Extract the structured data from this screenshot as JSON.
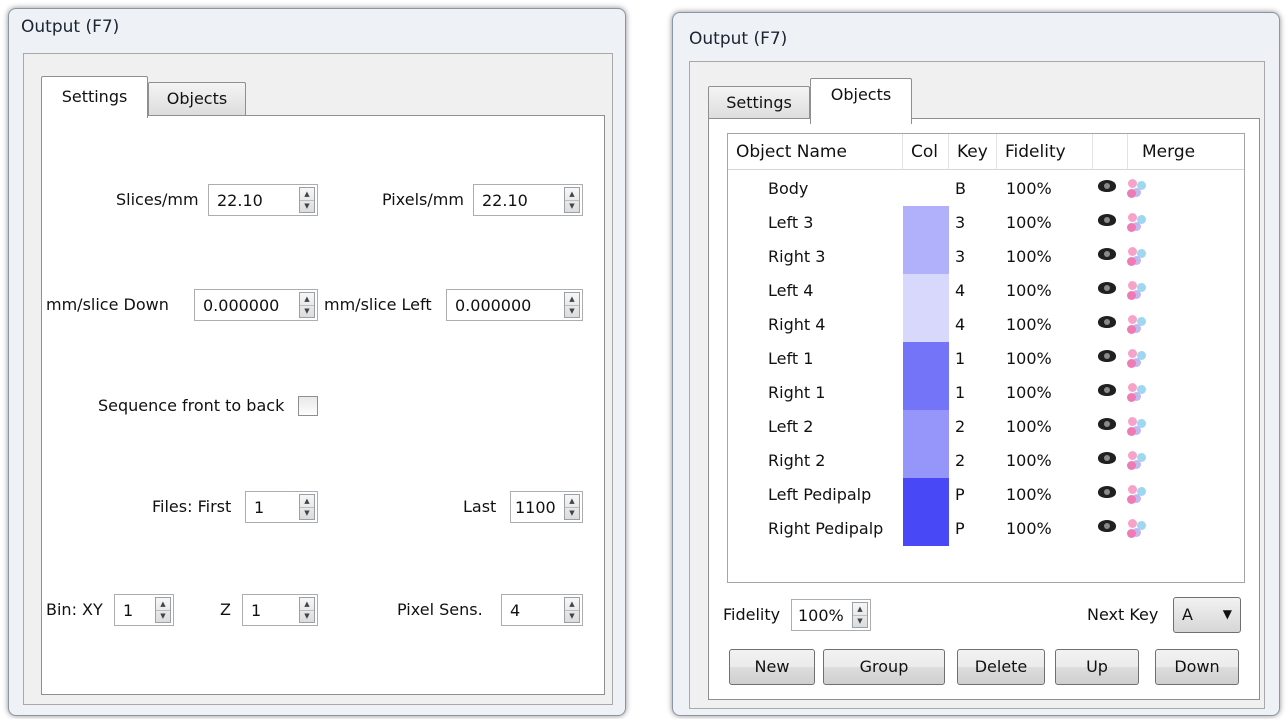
{
  "left_window": {
    "title": "Output (F7)",
    "tabs": [
      {
        "label": "Settings"
      },
      {
        "label": "Objects"
      }
    ],
    "settings": {
      "slices_per_mm": {
        "label": "Slices/mm",
        "value": "22.10"
      },
      "pixels_per_mm": {
        "label": "Pixels/mm",
        "value": "22.10"
      },
      "mm_slice_down": {
        "label": "mm/slice Down",
        "value": "0.000000"
      },
      "mm_slice_left": {
        "label": "mm/slice Left",
        "value": "0.000000"
      },
      "sequence_front_to_back": {
        "label": "Sequence front to back",
        "checked": false
      },
      "files_first": {
        "label": "Files: First",
        "value": "1"
      },
      "files_last": {
        "label": "Last",
        "value": "1100"
      },
      "bin_xy": {
        "label": "Bin: XY",
        "value": "1"
      },
      "bin_z": {
        "label": "Z",
        "value": "1"
      },
      "pixel_sens": {
        "label": "Pixel Sens.",
        "value": "4"
      }
    }
  },
  "right_window": {
    "title": "Output (F7)",
    "tabs": [
      {
        "label": "Settings"
      },
      {
        "label": "Objects"
      }
    ],
    "columns": {
      "name": "Object Name",
      "col": "Col",
      "key": "Key",
      "fidelity": "Fidelity",
      "visible": "",
      "merge": "Merge"
    },
    "objects": [
      {
        "name": "Body",
        "color": "",
        "key": "B",
        "fidelity": "100%"
      },
      {
        "name": "Left 3",
        "color": "#b0b0fb",
        "key": "3",
        "fidelity": "100%"
      },
      {
        "name": "Right 3",
        "color": "#b0b0fb",
        "key": "3",
        "fidelity": "100%"
      },
      {
        "name": "Left 4",
        "color": "#d8d8fd",
        "key": "4",
        "fidelity": "100%"
      },
      {
        "name": "Right 4",
        "color": "#d8d8fd",
        "key": "4",
        "fidelity": "100%"
      },
      {
        "name": "Left 1",
        "color": "#7474f9",
        "key": "1",
        "fidelity": "100%"
      },
      {
        "name": "Right 1",
        "color": "#7474f9",
        "key": "1",
        "fidelity": "100%"
      },
      {
        "name": "Left 2",
        "color": "#9595fa",
        "key": "2",
        "fidelity": "100%"
      },
      {
        "name": "Right 2",
        "color": "#9595fa",
        "key": "2",
        "fidelity": "100%"
      },
      {
        "name": "Left Pedipalp",
        "color": "#4848f7",
        "key": "P",
        "fidelity": "100%"
      },
      {
        "name": "Right Pedipalp",
        "color": "#4848f7",
        "key": "P",
        "fidelity": "100%"
      }
    ],
    "fidelity": {
      "label": "Fidelity",
      "value": "100%"
    },
    "next_key": {
      "label": "Next Key",
      "value": "A"
    },
    "buttons": {
      "new": "New",
      "group": "Group",
      "delete": "Delete",
      "up": "Up",
      "down": "Down"
    }
  }
}
